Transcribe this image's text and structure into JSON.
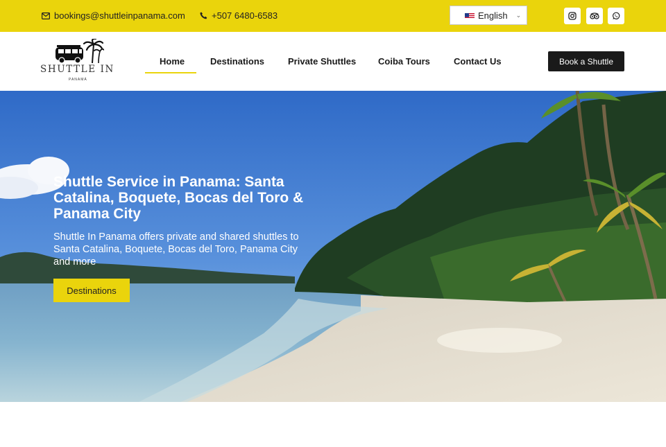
{
  "topbar": {
    "email": "bookings@shuttleinpanama.com",
    "phone": "+507 6480-6583",
    "language": "English",
    "social_icons": [
      "instagram-icon",
      "tripadvisor-icon",
      "whatsapp-icon"
    ]
  },
  "header": {
    "logo_text": "SHUTTLE IN",
    "logo_subtext": "PANAMÁ",
    "nav": [
      {
        "label": "Home",
        "active": true
      },
      {
        "label": "Destinations"
      },
      {
        "label": "Private Shuttles"
      },
      {
        "label": "Coiba Tours"
      },
      {
        "label": "Contact Us"
      }
    ],
    "cta": "Book a Shuttle"
  },
  "hero": {
    "title": "Shuttle Service in Panama: Santa Catalina, Boquete, Bocas del Toro & Panama City",
    "text": "Shuttle In Panama offers private and shared shuttles to Santa Catalina, Boquete, Bocas del Toro, Panama City and more",
    "button": "Destinations"
  },
  "colors": {
    "brand_yellow": "#ead40c",
    "dark": "#1a1a1a"
  }
}
